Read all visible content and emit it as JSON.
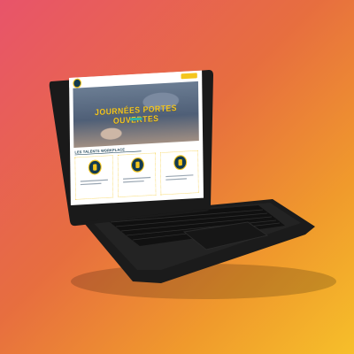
{
  "hero": {
    "title": "JOURNÉES PORTES OUVERTES"
  },
  "section": {
    "title": "LES TALENTS WORKPLACE"
  },
  "colors": {
    "accent": "#f4c51d",
    "primary": "#123a4f",
    "teal": "#2fb3a2"
  },
  "cards": [
    {
      "icon": "award-icon"
    },
    {
      "icon": "award-icon"
    },
    {
      "icon": "award-icon"
    }
  ]
}
